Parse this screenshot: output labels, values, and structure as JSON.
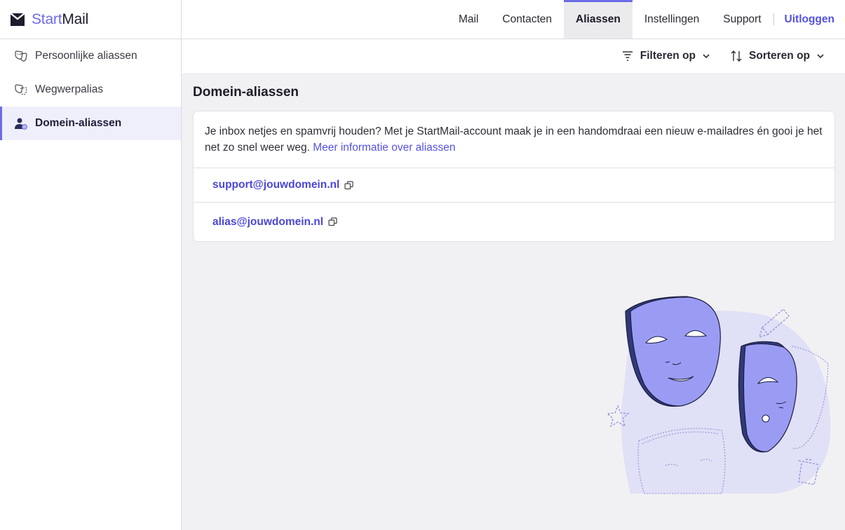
{
  "app": {
    "brand_start": "Start",
    "brand_mail": "Mail"
  },
  "colors": {
    "accent": "#6d6ce8",
    "link": "#5452e0",
    "background": "#f1f1f4"
  },
  "sidebar": {
    "items": [
      {
        "label": "Persoonlijke aliassen",
        "icon": "masks-icon",
        "active": false
      },
      {
        "label": "Wegwerpalias",
        "icon": "disposable-mask-icon",
        "active": false
      },
      {
        "label": "Domein-aliassen",
        "icon": "user-domain-icon",
        "active": true
      }
    ]
  },
  "topnav": {
    "tabs": [
      {
        "label": "Mail"
      },
      {
        "label": "Contacten"
      },
      {
        "label": "Aliassen"
      },
      {
        "label": "Instellingen"
      },
      {
        "label": "Support"
      }
    ],
    "active_tab": "Aliassen",
    "logout_label": "Uitloggen"
  },
  "toolbar": {
    "filter_label": "Filteren op",
    "sort_label": "Sorteren op"
  },
  "main": {
    "title": "Domein-aliassen",
    "intro_text": "Je inbox netjes en spamvrij houden? Met je StartMail-account maak je in een handomdraai een nieuw e-mailadres én gooi je het net zo snel weer weg.",
    "intro_link": "Meer informatie over aliassen",
    "aliases": [
      {
        "address": "support@jouwdomein.nl"
      },
      {
        "address": "alias@jouwdomein.nl"
      }
    ]
  }
}
